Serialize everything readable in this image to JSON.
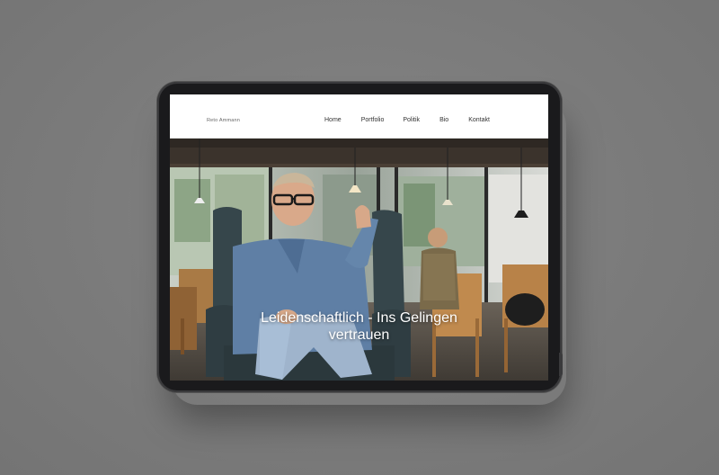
{
  "header": {
    "brand": "Reto Ammann",
    "nav": [
      {
        "label": "Home"
      },
      {
        "label": "Portfolio"
      },
      {
        "label": "Politik"
      },
      {
        "label": "Bio"
      },
      {
        "label": "Kontakt"
      }
    ]
  },
  "hero": {
    "title_line1": "Leidenschaftlich - Ins Gelingen",
    "title_line2": "vertrauen"
  },
  "colors": {
    "background": "#7a7a7a",
    "device_bezel": "#1a1a1c",
    "header_bg": "#ffffff",
    "hero_text": "#ffffff"
  }
}
